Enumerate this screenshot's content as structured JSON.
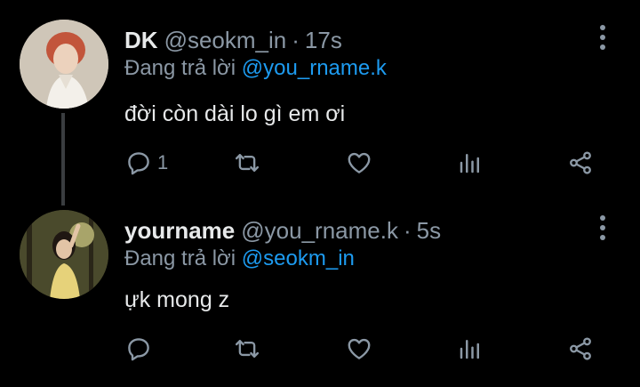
{
  "colors": {
    "background": "#000000",
    "text": "#e7e9ea",
    "muted": "#8b98a5",
    "accent": "#1d9bf0"
  },
  "tweets": [
    {
      "display_name": "DK",
      "handle": "@seokm_in",
      "separator": "·",
      "time": "17s",
      "reply_prefix": "Đang trả lời",
      "reply_to": "@you_rname.k",
      "text": "đời còn dài lo gì em ơi",
      "reply_count": "1",
      "avatar_icon": "avatar-photo"
    },
    {
      "display_name": "yourname",
      "handle": "@you_rname.k",
      "separator": "·",
      "time": "5s",
      "reply_prefix": "Đang trả lời",
      "reply_to": "@seokm_in",
      "text": "ựk mong z",
      "reply_count": "",
      "avatar_icon": "avatar-photo"
    }
  ],
  "icons": [
    "reply-icon",
    "retweet-icon",
    "like-icon",
    "stats-icon",
    "share-icon",
    "more-icon"
  ]
}
